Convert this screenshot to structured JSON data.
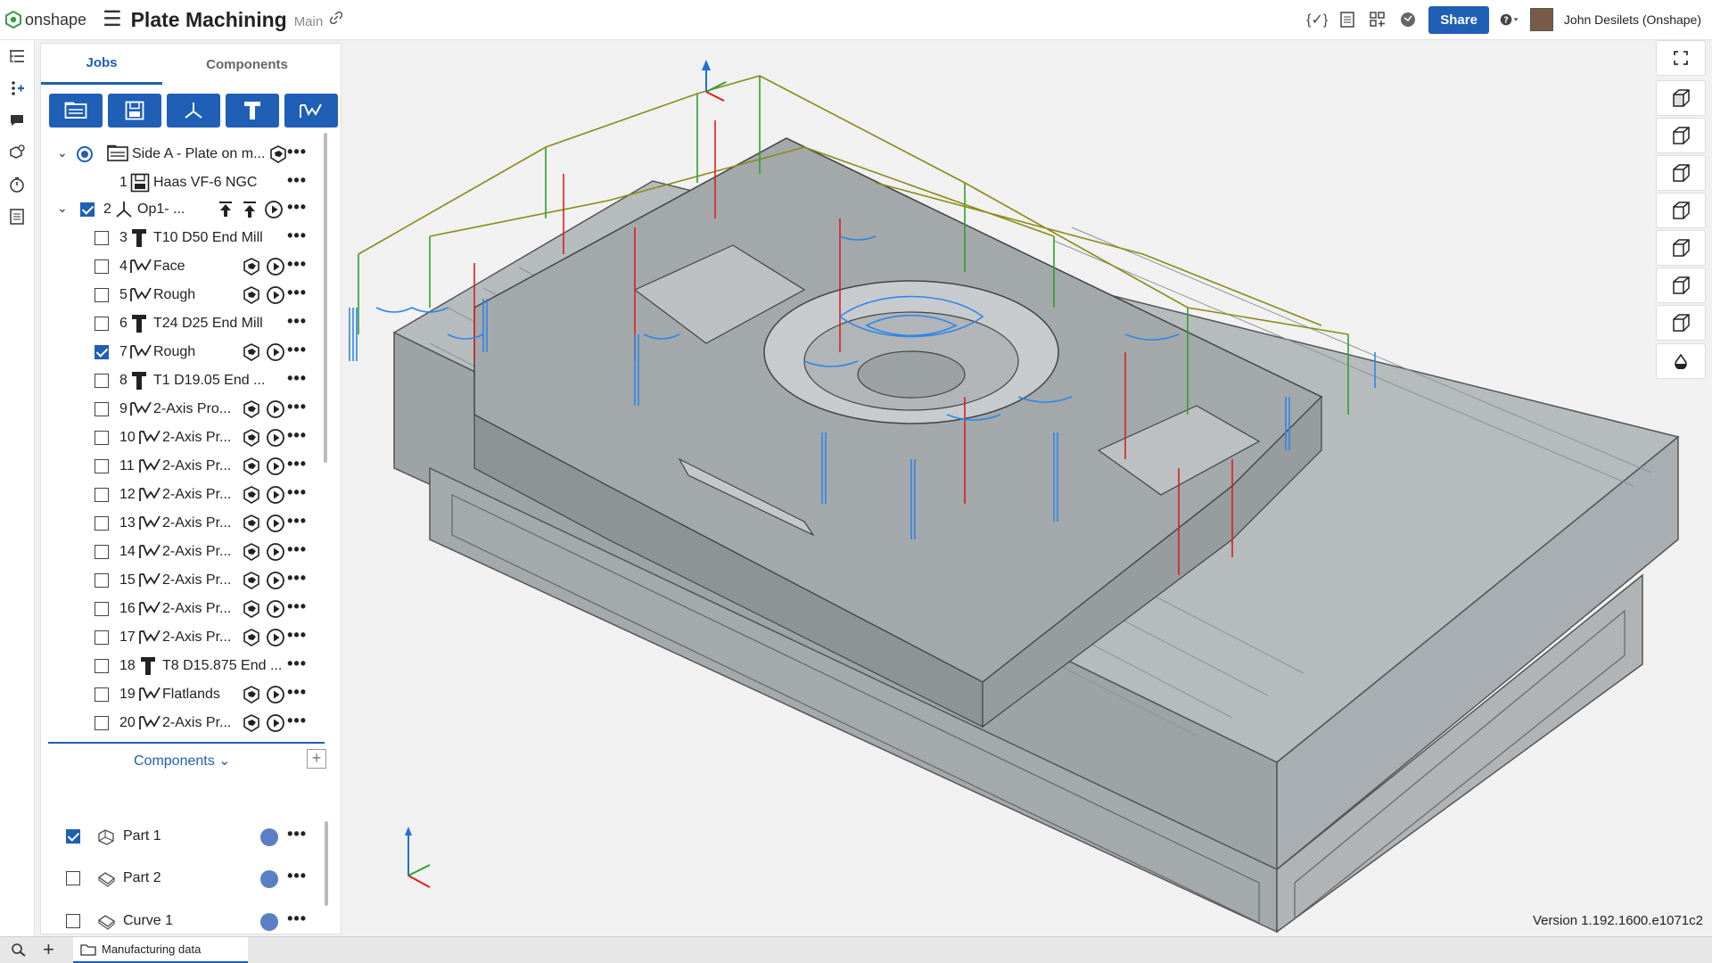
{
  "app": {
    "brand": "onshape",
    "document_title": "Plate Machining",
    "branch": "Main",
    "version": "Version 1.192.1600.e1071c2"
  },
  "header": {
    "share_label": "Share",
    "user_name": "John Desilets (Onshape)"
  },
  "panel": {
    "tabs": [
      {
        "label": "Jobs",
        "active": true
      },
      {
        "label": "Components",
        "active": false
      }
    ],
    "tree": [
      {
        "type": "setup",
        "label": "Side A - Plate on m...",
        "expanded": true,
        "radio": true
      },
      {
        "type": "machine",
        "num": "1",
        "label": "Haas VF-6 NGC"
      },
      {
        "type": "op",
        "num": "2",
        "label": "Op1- ...",
        "checked": true,
        "expanded": true
      },
      {
        "type": "tool",
        "num": "3",
        "label": "T10 D50 End Mill",
        "checked": false
      },
      {
        "type": "toolpath",
        "num": "4",
        "label": "Face",
        "checked": false
      },
      {
        "type": "toolpath",
        "num": "5",
        "label": "Rough",
        "checked": false
      },
      {
        "type": "tool",
        "num": "6",
        "label": "T24 D25 End Mill",
        "checked": false
      },
      {
        "type": "toolpath",
        "num": "7",
        "label": "Rough",
        "checked": true
      },
      {
        "type": "tool",
        "num": "8",
        "label": "T1 D19.05 End ...",
        "checked": false
      },
      {
        "type": "toolpath",
        "num": "9",
        "label": "2-Axis Pro...",
        "checked": false
      },
      {
        "type": "toolpath",
        "num": "10",
        "label": "2-Axis Pr...",
        "checked": false
      },
      {
        "type": "toolpath",
        "num": "11",
        "label": "2-Axis Pr...",
        "checked": false
      },
      {
        "type": "toolpath",
        "num": "12",
        "label": "2-Axis Pr...",
        "checked": false
      },
      {
        "type": "toolpath",
        "num": "13",
        "label": "2-Axis Pr...",
        "checked": false
      },
      {
        "type": "toolpath",
        "num": "14",
        "label": "2-Axis Pr...",
        "checked": false
      },
      {
        "type": "toolpath",
        "num": "15",
        "label": "2-Axis Pr...",
        "checked": false
      },
      {
        "type": "toolpath",
        "num": "16",
        "label": "2-Axis Pr...",
        "checked": false
      },
      {
        "type": "toolpath",
        "num": "17",
        "label": "2-Axis Pr...",
        "checked": false
      },
      {
        "type": "tool",
        "num": "18",
        "label": "T8 D15.875 End ...",
        "checked": false
      },
      {
        "type": "toolpath",
        "num": "19",
        "label": "Flatlands",
        "checked": false
      },
      {
        "type": "toolpath",
        "num": "20",
        "label": "2-Axis Pr...",
        "checked": false
      }
    ],
    "components_header": "Components",
    "components": [
      {
        "label": "Part 1",
        "checked": true
      },
      {
        "label": "Part 2",
        "checked": false
      },
      {
        "label": "Curve 1",
        "checked": false
      }
    ]
  },
  "bottom": {
    "tab_label": "Manufacturing data"
  },
  "colors": {
    "accent": "#1f5fb5",
    "part_gray": "#a9aeb2",
    "path_blue": "#2f86e6",
    "path_red": "#d62020",
    "path_green": "#2ea02e",
    "path_olive": "#8a8a16"
  }
}
